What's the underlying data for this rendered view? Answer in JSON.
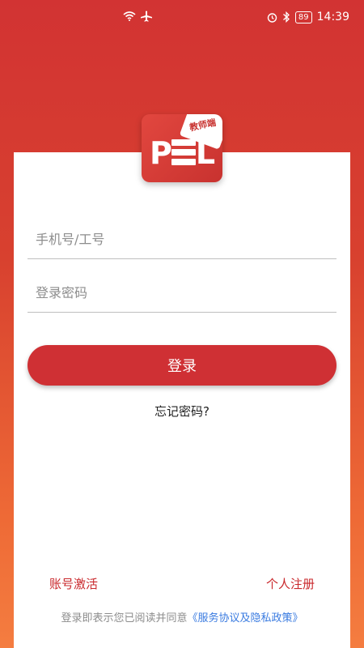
{
  "status_bar": {
    "wifi_icon": "wifi-icon",
    "airplane_icon": "airplane-icon",
    "alarm_icon": "alarm-icon",
    "bluetooth_icon": "bluetooth-icon",
    "battery": "89",
    "time": "14:39"
  },
  "logo": {
    "text_p": "P",
    "text_l": "L",
    "badge": "教师端"
  },
  "form": {
    "account_placeholder": "手机号/工号",
    "password_placeholder": "登录密码",
    "login_label": "登录",
    "forgot_label": "忘记密码?"
  },
  "footer": {
    "activate_label": "账号激活",
    "register_label": "个人注册",
    "agree_prefix": "登录即表示您已阅读并同意",
    "policy_link": "《服务协议及隐私政策》"
  },
  "colors": {
    "primary": "#cf3034",
    "link_blue": "#3a7be0"
  }
}
